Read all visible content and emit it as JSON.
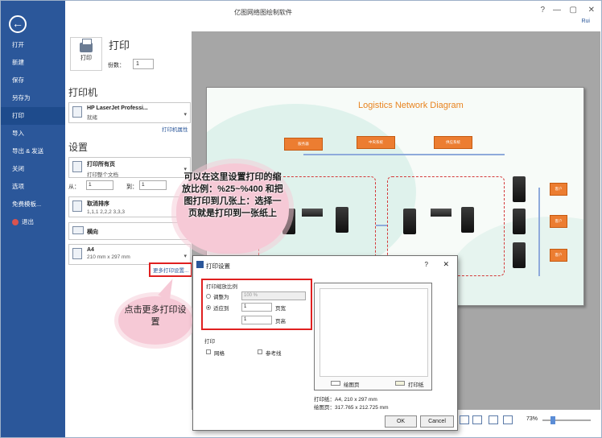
{
  "window": {
    "title": "亿图网络图绘制软件",
    "user": "Rui",
    "controls": [
      "?",
      "—",
      "▢",
      "✕"
    ]
  },
  "sidebar": {
    "items": [
      {
        "label": "打开"
      },
      {
        "label": "新建"
      },
      {
        "label": "保存"
      },
      {
        "label": "另存为"
      },
      {
        "label": "打印",
        "active": true
      },
      {
        "label": "导入"
      },
      {
        "label": "导出 & 发送"
      },
      {
        "label": "关闭"
      },
      {
        "label": "选项"
      },
      {
        "label": "免费模板..."
      },
      {
        "label": "退出"
      }
    ]
  },
  "print_panel": {
    "heading": "打印",
    "print_button": "打印",
    "copies_label": "份数：",
    "copies_value": "1",
    "printer_heading": "打印机",
    "printer_name": "HP LaserJet Professi...",
    "printer_status": "就绪",
    "printer_props_link": "打印机属性",
    "settings_heading": "设置",
    "print_all_title": "打印所有页",
    "print_all_sub": "打印整个文档",
    "from_label": "从：",
    "from_value": "1",
    "to_label": "到：",
    "to_value": "1",
    "collate_title": "取消排序",
    "collate_sub": "1,1,1  2,2,2  3,3,3",
    "orientation_title": "横向",
    "paper_title": "A4",
    "paper_sub": "210 mm x 297 mm",
    "more_settings_link": "更多打印设置..."
  },
  "preview": {
    "diagram_title": "Logistics Network Diagram",
    "boxes": [
      "服务器",
      "中央系统",
      "供应系统",
      "客户",
      "客户",
      "客户"
    ]
  },
  "callouts": {
    "scale_note": "可以在这里设置打印的缩放比例：%25~%400 和把图打印到几张上：选择一页就是打印到一张纸上",
    "more_note": "点击更多打印设置"
  },
  "dialog": {
    "title": "打印设置",
    "help": "?",
    "close": "✕",
    "scale_group": "打印缩放比例",
    "adjust_label": "调整为",
    "adjust_value": "100 %",
    "fit_label": "适应到",
    "fit_value_1": "1",
    "fit_unit_1": "页宽",
    "fit_value_2": "1",
    "fit_unit_2": "页高",
    "print_group": "打印",
    "grid_label": "网格",
    "guides_label": "参考线",
    "legend_page": "绘图页",
    "legend_paper": "打印纸",
    "paper_info": "打印纸：A4, 210 x 297 mm",
    "page_info": "绘图页：317.765 x 212.725 mm",
    "ok": "OK",
    "cancel": "Cancel"
  },
  "status": {
    "zoom": "73%"
  }
}
